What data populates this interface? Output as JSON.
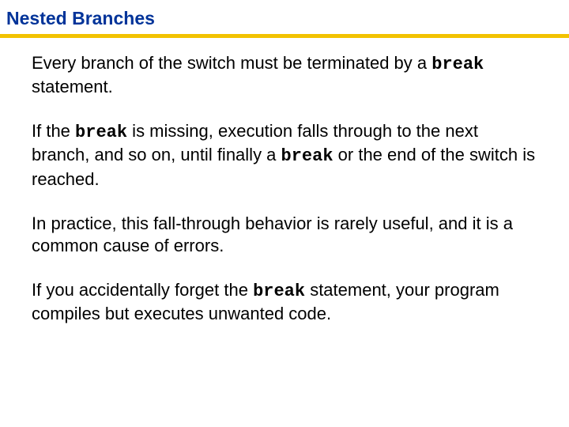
{
  "title": "Nested Branches",
  "p1a": "Every branch of the switch must be terminated by a ",
  "kw_break1": "break",
  "p1b": " statement.",
  "p2a": "If the ",
  "kw_break2": "break",
  "p2b": " is missing, execution falls through to the next branch, and so on, until finally a ",
  "kw_break3": "break",
  "p2c": " or the end of the switch is reached.",
  "p3": "In practice, this fall-through behavior is rarely useful, and it is a common cause of errors.",
  "p4a": "If you accidentally forget the ",
  "kw_break4": "break",
  "p4b": " statement, your program compiles but executes unwanted code."
}
